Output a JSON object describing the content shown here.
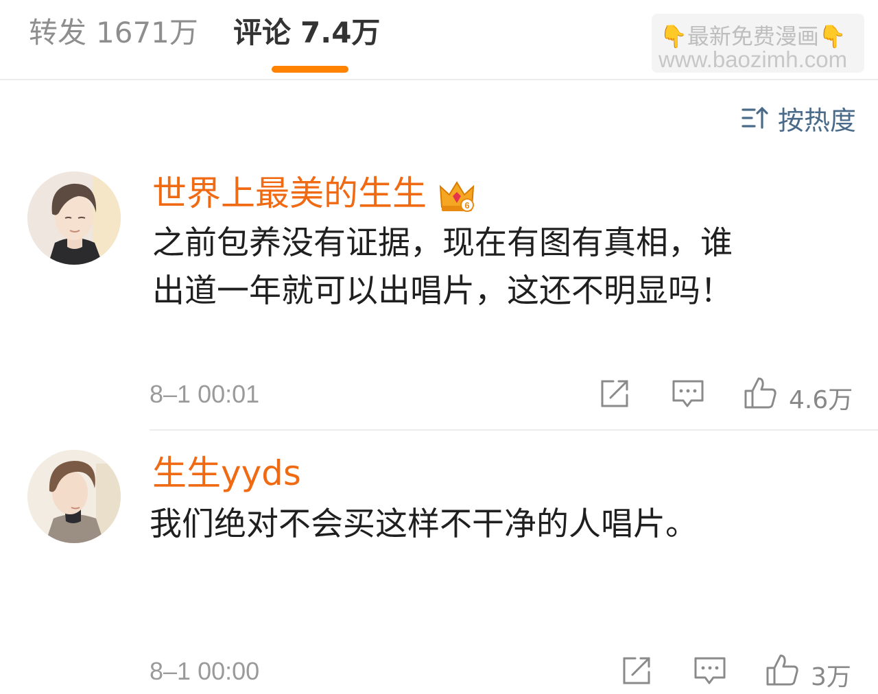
{
  "tabs": {
    "repost": {
      "label": "转发",
      "count": "1671万"
    },
    "comments": {
      "label": "评论",
      "count": "7.4万"
    }
  },
  "watermark": {
    "line1": "最新免费漫画",
    "hand_left": "👇",
    "hand_right": "👇",
    "line2": "www.baozimh.com"
  },
  "sort": {
    "label": "按热度",
    "icon": "sort-icon"
  },
  "colors": {
    "accent": "#ff8200",
    "username": "#f06a14",
    "sort": "#4a6a8a"
  },
  "comments": [
    {
      "username": "世界上最美的生生",
      "badge": "crown-badge-level-6",
      "badge_number": "6",
      "text_line1": "之前包养没有证据，现在有图有真相，谁",
      "text_line2": "出道一年就可以出唱片，这还不明显吗！",
      "time": "8–1 00:01",
      "likes": "4.6万"
    },
    {
      "username": "生生yyds",
      "text_line1": "我们绝对不会买这样不干净的人唱片。",
      "time": "8–1 00:00",
      "likes": "3万"
    }
  ]
}
